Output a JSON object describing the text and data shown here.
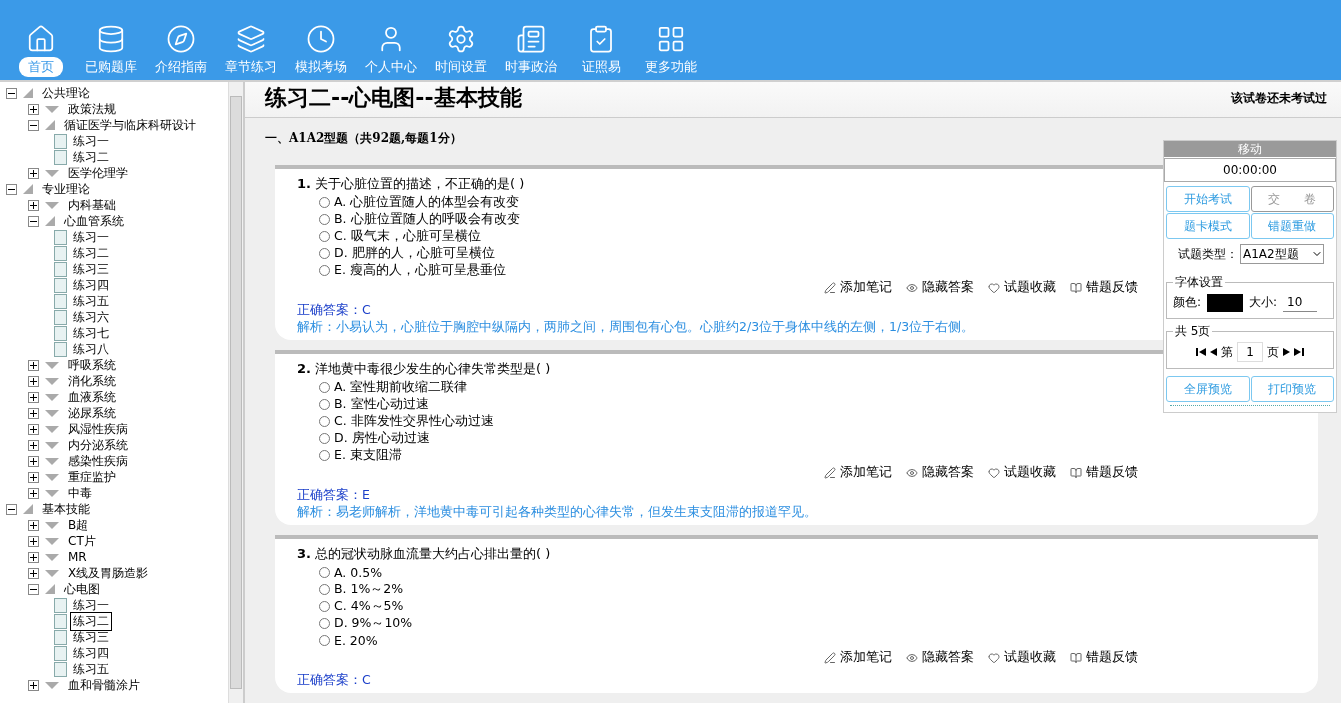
{
  "toolbar": [
    {
      "label": "首页",
      "selected": true
    },
    {
      "label": "已购题库",
      "selected": false
    },
    {
      "label": "介绍指南",
      "selected": false
    },
    {
      "label": "章节练习",
      "selected": false
    },
    {
      "label": "模拟考场",
      "selected": false
    },
    {
      "label": "个人中心",
      "selected": false
    },
    {
      "label": "时间设置",
      "selected": false
    },
    {
      "label": "时事政治",
      "selected": false
    },
    {
      "label": "证照易",
      "selected": false
    },
    {
      "label": "更多功能",
      "selected": false
    }
  ],
  "tree": [
    {
      "label": "公共理论",
      "kind": "folder",
      "expanded": true,
      "children": [
        {
          "label": "政策法规",
          "kind": "folder",
          "expanded": false
        },
        {
          "label": "循证医学与临床科研设计",
          "kind": "folder",
          "expanded": true,
          "children": [
            {
              "label": "练习一",
              "kind": "exercise",
              "selected": false
            },
            {
              "label": "练习二",
              "kind": "exercise",
              "selected": false
            }
          ]
        },
        {
          "label": "医学伦理学",
          "kind": "folder",
          "expanded": false
        }
      ]
    },
    {
      "label": "专业理论",
      "kind": "folder",
      "expanded": true,
      "children": [
        {
          "label": "内科基础",
          "kind": "folder",
          "expanded": false
        },
        {
          "label": "心血管系统",
          "kind": "folder",
          "expanded": true,
          "children": [
            {
              "label": "练习一",
              "kind": "exercise",
              "selected": false
            },
            {
              "label": "练习二",
              "kind": "exercise",
              "selected": false
            },
            {
              "label": "练习三",
              "kind": "exercise",
              "selected": false
            },
            {
              "label": "练习四",
              "kind": "exercise",
              "selected": false
            },
            {
              "label": "练习五",
              "kind": "exercise",
              "selected": false
            },
            {
              "label": "练习六",
              "kind": "exercise",
              "selected": false
            },
            {
              "label": "练习七",
              "kind": "exercise",
              "selected": false
            },
            {
              "label": "练习八",
              "kind": "exercise",
              "selected": false
            }
          ]
        },
        {
          "label": "呼吸系统",
          "kind": "folder",
          "expanded": false
        },
        {
          "label": "消化系统",
          "kind": "folder",
          "expanded": false
        },
        {
          "label": "血液系统",
          "kind": "folder",
          "expanded": false
        },
        {
          "label": "泌尿系统",
          "kind": "folder",
          "expanded": false
        },
        {
          "label": "风湿性疾病",
          "kind": "folder",
          "expanded": false
        },
        {
          "label": "内分泌系统",
          "kind": "folder",
          "expanded": false
        },
        {
          "label": "感染性疾病",
          "kind": "folder",
          "expanded": false
        },
        {
          "label": "重症监护",
          "kind": "folder",
          "expanded": false
        },
        {
          "label": "中毒",
          "kind": "folder",
          "expanded": false
        }
      ]
    },
    {
      "label": "基本技能",
      "kind": "folder",
      "expanded": true,
      "children": [
        {
          "label": "B超",
          "kind": "folder",
          "expanded": false
        },
        {
          "label": "CT片",
          "kind": "folder",
          "expanded": false
        },
        {
          "label": "MR",
          "kind": "folder",
          "expanded": false
        },
        {
          "label": "X线及胃肠造影",
          "kind": "folder",
          "expanded": false
        },
        {
          "label": "心电图",
          "kind": "folder",
          "expanded": true,
          "children": [
            {
              "label": "练习一",
              "kind": "exercise",
              "selected": false
            },
            {
              "label": "练习二",
              "kind": "exercise",
              "selected": true
            },
            {
              "label": "练习三",
              "kind": "exercise",
              "selected": false
            },
            {
              "label": "练习四",
              "kind": "exercise",
              "selected": false
            },
            {
              "label": "练习五",
              "kind": "exercise",
              "selected": false
            }
          ]
        },
        {
          "label": "血和骨髓涂片",
          "kind": "folder",
          "expanded": false
        }
      ]
    }
  ],
  "paper": {
    "title": "练习二--心电图--基本技能",
    "status": "该试卷还未考试过",
    "section": "一、A1A2型题（共92题,每题1分）"
  },
  "questions": [
    {
      "text": "**1.** 关于心脏位置的描述，不正确的是( )",
      "options": [
        {
          "text": "A. 心脏位置随人的体型会有改变",
          "selected": false
        },
        {
          "text": "B. 心脏位置随人的呼吸会有改变",
          "selected": false
        },
        {
          "text": "C. 吸气末，心脏可呈横位",
          "selected": false
        },
        {
          "text": "D. 肥胖的人，心脏可呈横位",
          "selected": false
        },
        {
          "text": "E. 瘦高的人，心脏可呈悬垂位",
          "selected": false
        }
      ],
      "actions": [
        "添加笔记",
        "隐藏答案",
        "试题收藏",
        "错题反馈"
      ],
      "answer": "正确答案：C",
      "analysis": "解析：小易认为，心脏位于胸腔中纵隔内，两肺之间，周围包有心包。心脏约2/3位于身体中线的左侧，1/3位于右侧。"
    },
    {
      "text": "**2.** 洋地黄中毒很少发生的心律失常类型是( )",
      "options": [
        {
          "text": "A. 室性期前收缩二联律",
          "selected": false
        },
        {
          "text": "B. 室性心动过速",
          "selected": false
        },
        {
          "text": "C. 非阵发性交界性心动过速",
          "selected": false
        },
        {
          "text": "D. 房性心动过速",
          "selected": false
        },
        {
          "text": "E. 束支阻滞",
          "selected": false
        }
      ],
      "actions": [
        "添加笔记",
        "隐藏答案",
        "试题收藏",
        "错题反馈"
      ],
      "answer": "正确答案：E",
      "analysis": "解析：易老师解析，洋地黄中毒可引起各种类型的心律失常，但发生束支阻滞的报道罕见。"
    },
    {
      "text": "**3.** 总的冠状动脉血流量大约占心排出量的( )",
      "options": [
        {
          "text": "A. 0.5%",
          "selected": false
        },
        {
          "text": "B. 1%～2%",
          "selected": false
        },
        {
          "text": "C. 4%～5%",
          "selected": false
        },
        {
          "text": "D. 9%～10%",
          "selected": false
        },
        {
          "text": "E. 20%",
          "selected": false
        }
      ],
      "actions": [
        "添加笔记",
        "隐藏答案",
        "试题收藏",
        "错题反馈"
      ],
      "answer": "正确答案：C"
    }
  ],
  "panel": {
    "header": "移动",
    "timer": "00:00:00",
    "buttons": [
      {
        "label": "开始考试",
        "disabled": false
      },
      {
        "label": "交　　卷",
        "disabled": true
      },
      {
        "label": "题卡模式",
        "disabled": false
      },
      {
        "label": "错题重做",
        "disabled": false
      }
    ],
    "type_label": "试题类型：",
    "type_value": "A1A2型题",
    "font_legend": "字体设置",
    "color_label": "颜色:",
    "color": "#000000",
    "size_label": "大小:",
    "size_value": "10",
    "pages_legend": "共 5页",
    "page_prefix": "第",
    "page_value": "1",
    "page_suffix": "页",
    "bottom_buttons": [
      "全屏预览",
      "打印预览"
    ]
  }
}
